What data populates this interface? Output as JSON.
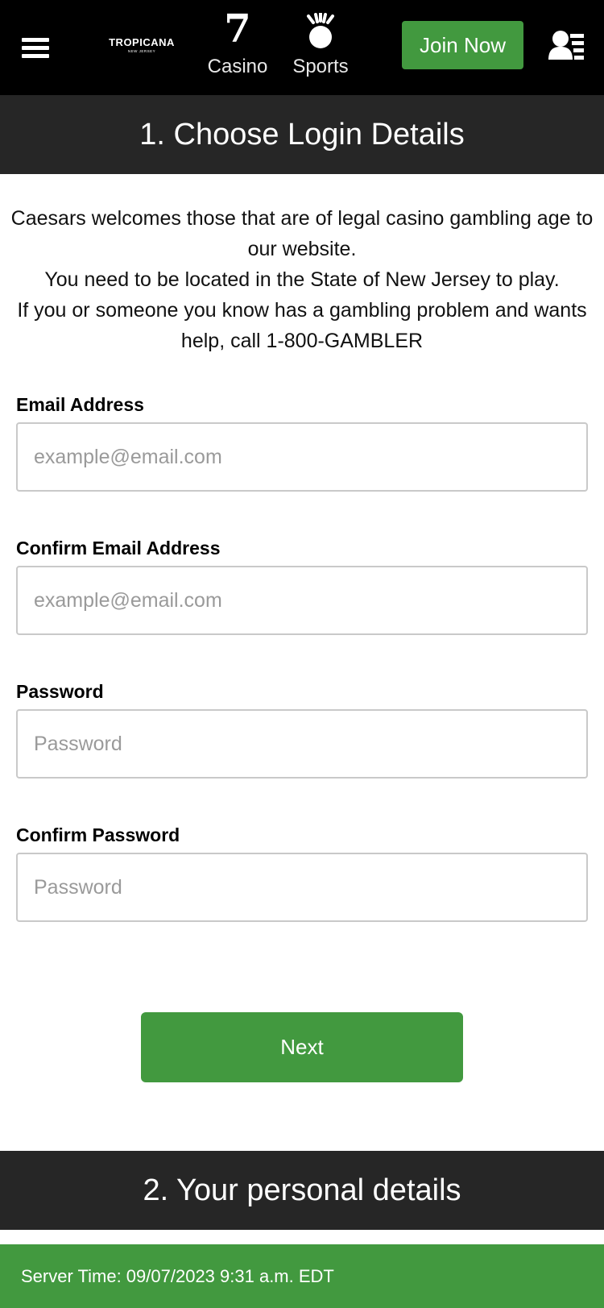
{
  "header": {
    "logo_text": "TROPICANA",
    "logo_subtext": "NEW JERSEY",
    "nav": {
      "casino": {
        "icon": "seven-icon",
        "glyph": "7",
        "label": "Casino"
      },
      "sports": {
        "icon": "trophy-icon",
        "label": "Sports"
      }
    },
    "join_label": "Join Now",
    "menu_icon": "hamburger-menu-icon",
    "account_icon": "account-icon"
  },
  "step1": {
    "title": "1. Choose Login Details",
    "intro": [
      "Caesars welcomes those that are of legal casino gambling age to our website.",
      "You need to be located in the State of New Jersey to play.",
      "If you or someone you know has a gambling problem and wants help, call 1-800-GAMBLER"
    ],
    "fields": {
      "email": {
        "label": "Email Address",
        "placeholder": "example@email.com",
        "value": ""
      },
      "confirm_email": {
        "label": "Confirm Email Address",
        "placeholder": "example@email.com",
        "value": ""
      },
      "password": {
        "label": "Password",
        "placeholder": "Password",
        "value": ""
      },
      "confirm_password": {
        "label": "Confirm Password",
        "placeholder": "Password",
        "value": ""
      }
    },
    "next_label": "Next"
  },
  "step2": {
    "title": "2. Your personal details"
  },
  "footer": {
    "server_time": "Server Time: 09/07/2023 9:31 a.m. EDT"
  },
  "colors": {
    "brand_green": "#42993f",
    "header_black": "#000000",
    "section_dark": "#262626"
  }
}
